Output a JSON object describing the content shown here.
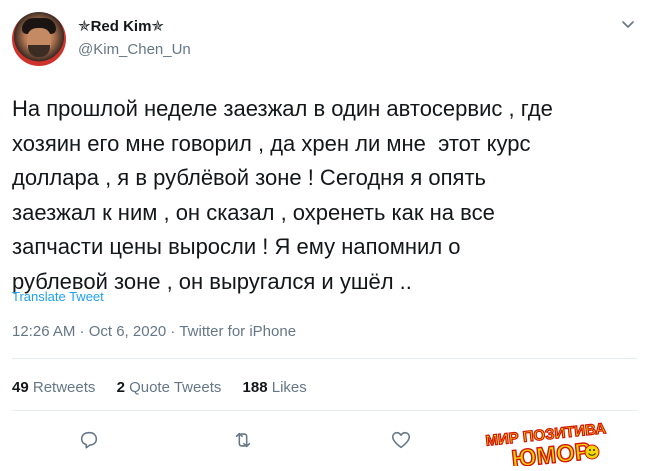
{
  "tweet": {
    "display_name": "✯Red Kim✯",
    "handle": "@Kim_Chen_Un",
    "text": "На прошлой неделе заезжал в один автосервис , где\nхозяин его мне говорил , да хрен ли мне  этот курс\nдоллара , я в рублёвой зоне ! Сегодня я опять\nзаезжал к ним , он сказал , охренеть как на все\nзапчасти цены выросли ! Я ему напомнил о\nрублевой зоне , он выругался и ушёл ..",
    "translate_label": "Translate Tweet",
    "timestamp": "12:26 AM · Oct 6, 2020 · Twitter for iPhone"
  },
  "stats": {
    "retweets_count": "49",
    "retweets_label": "Retweets",
    "quotes_count": "2",
    "quotes_label": "Quote Tweets",
    "likes_count": "188",
    "likes_label": "Likes"
  },
  "icons": {
    "reply": "reply-icon",
    "retweet": "retweet-icon",
    "like": "heart-icon",
    "more": "chevron-down-icon"
  },
  "watermark": {
    "line1": "МИР ПОЗИТИВА",
    "line2": "ЮМОР"
  },
  "colors": {
    "text": "#14171a",
    "secondary": "#657786",
    "link": "#1da1f2",
    "divider": "#e6ecf0"
  }
}
